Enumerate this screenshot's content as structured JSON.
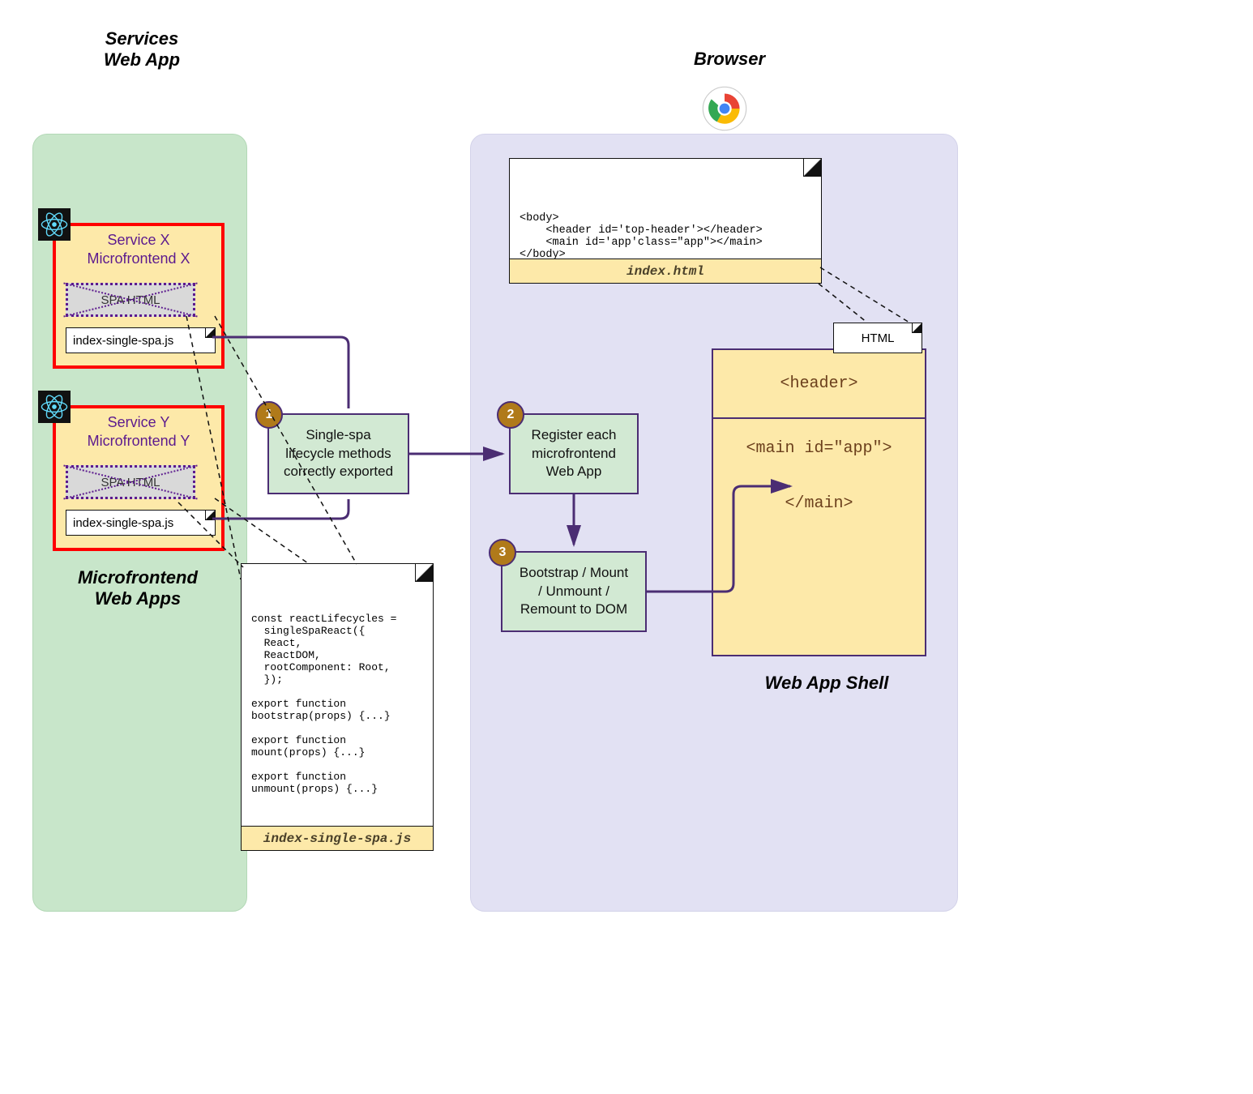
{
  "titles": {
    "services": "Services\nWeb App",
    "microfrontends": "Microfrontend\nWeb Apps",
    "browser": "Browser",
    "shell": "Web App Shell"
  },
  "mf": {
    "x": {
      "title": "Service X\nMicrofrontend X",
      "spa_label": "SPA HTML",
      "file": "index-single-spa.js"
    },
    "y": {
      "title": "Service Y\nMicrofrontend Y",
      "spa_label": "SPA HTML",
      "file": "index-single-spa.js"
    }
  },
  "steps": {
    "s1": {
      "num": "1",
      "label": "Single-spa\nlifecycle methods\ncorrectly exported"
    },
    "s2": {
      "num": "2",
      "label": "Register each\nmicrofrontend\nWeb App"
    },
    "s3": {
      "num": "3",
      "label": "Bootstrap / Mount\n/ Unmount /\nRemount to DOM"
    }
  },
  "code": {
    "file_label": "index-single-spa.js",
    "body": "const reactLifecycles =\n  singleSpaReact({\n  React,\n  ReactDOM,\n  rootComponent: Root,\n  });\n\nexport function\nbootstrap(props) {...}\n\nexport function\nmount(props) {...}\n\nexport function\nunmount(props) {...}"
  },
  "index_html": {
    "body": "<body>\n    <header id='top-header'></header>\n    <main id='app'class=\"app\"></main>\n</body>",
    "label": "index.html"
  },
  "shell": {
    "html_chip": "HTML",
    "header_tag": "<header>",
    "main_open": "<main id=\"app\">",
    "main_close": "</main>"
  }
}
